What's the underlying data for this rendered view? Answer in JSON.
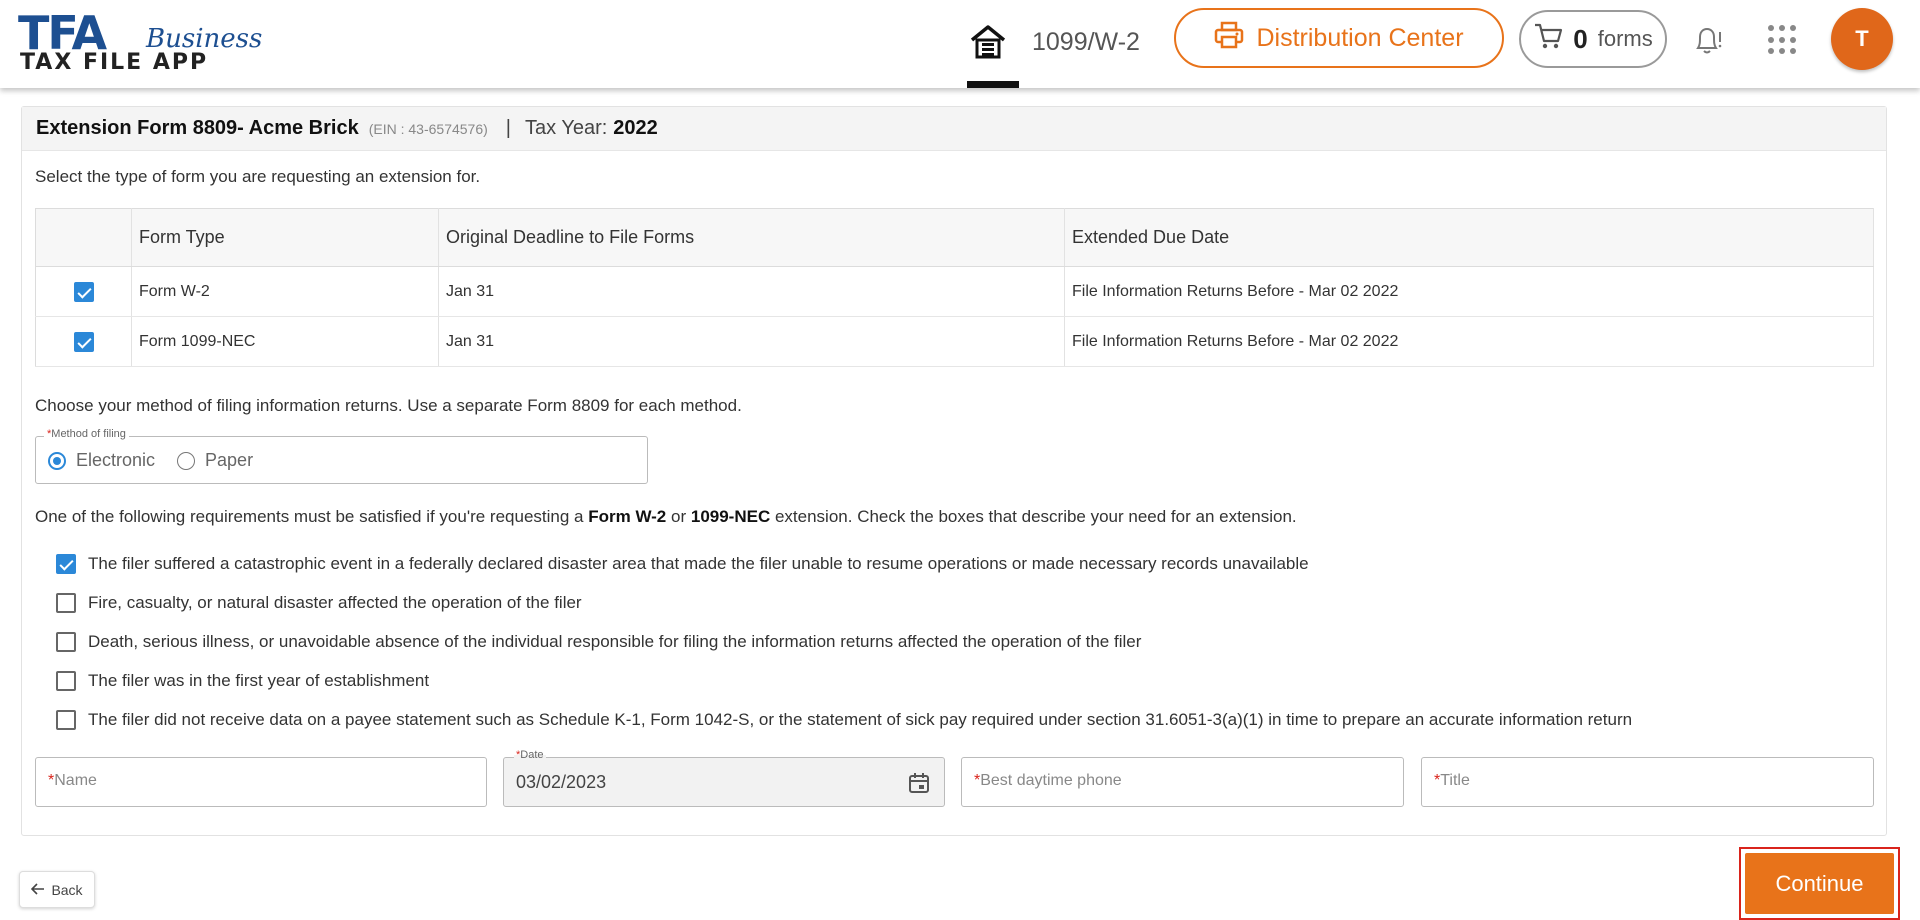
{
  "header": {
    "logo": {
      "main": "TFA",
      "suffix": "Business",
      "sub": "TAX FILE APP"
    },
    "nav_1099": "1099/W-2",
    "distribution_label": "Distribution Center",
    "cart_count": "0",
    "cart_label": "forms",
    "avatar_initial": "T"
  },
  "form_header": {
    "title": "Extension Form 8809- Acme Brick",
    "ein": "(EIN : 43-6574576)",
    "separator": "|",
    "tax_year_label": "Tax Year:",
    "tax_year": "2022"
  },
  "intro": "Select the type of form you are requesting an extension for.",
  "table": {
    "columns": [
      "",
      "Form Type",
      "Original Deadline to File Forms",
      "Extended Due Date"
    ],
    "rows": [
      {
        "checked": true,
        "form_type": "Form W-2",
        "deadline": "Jan 31",
        "extended": "File Information Returns Before - Mar 02 2022"
      },
      {
        "checked": true,
        "form_type": "Form 1099-NEC",
        "deadline": "Jan 31",
        "extended": "File Information Returns Before - Mar 02 2022"
      }
    ]
  },
  "method": {
    "text": "Choose your method of filing information returns. Use a separate Form 8809 for each method.",
    "legend_req": "*",
    "legend": "Method of filing",
    "options": [
      {
        "label": "Electronic",
        "selected": true
      },
      {
        "label": "Paper",
        "selected": false
      }
    ]
  },
  "requirements": {
    "pre": "One of the following requirements must be satisfied if you're requesting a",
    "form_a": "Form W-2",
    "or": "or",
    "form_b": "1099-NEC",
    "post": "extension. Check the boxes that describe your need for an extension.",
    "reasons": [
      {
        "checked": true,
        "label": "The filer suffered a catastrophic event in a federally declared disaster area that made the filer unable to resume operations or made necessary records unavailable"
      },
      {
        "checked": false,
        "label": "Fire, casualty, or natural disaster affected the operation of the filer"
      },
      {
        "checked": false,
        "label": "Death, serious illness, or unavoidable absence of the individual responsible for filing the information returns affected the operation of the filer"
      },
      {
        "checked": false,
        "label": "The filer was in the first year of establishment"
      },
      {
        "checked": false,
        "label": "The filer did not receive data on a payee statement such as Schedule K-1, Form 1042-S, or the statement of sick pay required under section 31.6051-3(a)(1) in time to prepare an accurate information return"
      }
    ]
  },
  "fields": {
    "required_mark": "*",
    "name_placeholder": "Name",
    "date_label": "Date",
    "date_value": "03/02/2023",
    "phone_placeholder": "Best daytime phone",
    "title_placeholder": "Title"
  },
  "footer": {
    "back_label": "Back",
    "continue_label": "Continue"
  },
  "colors": {
    "brand_orange": "#e8731a",
    "brand_blue": "#1d4f91",
    "check_blue": "#2b88d8",
    "highlight_red": "#d9241c"
  }
}
